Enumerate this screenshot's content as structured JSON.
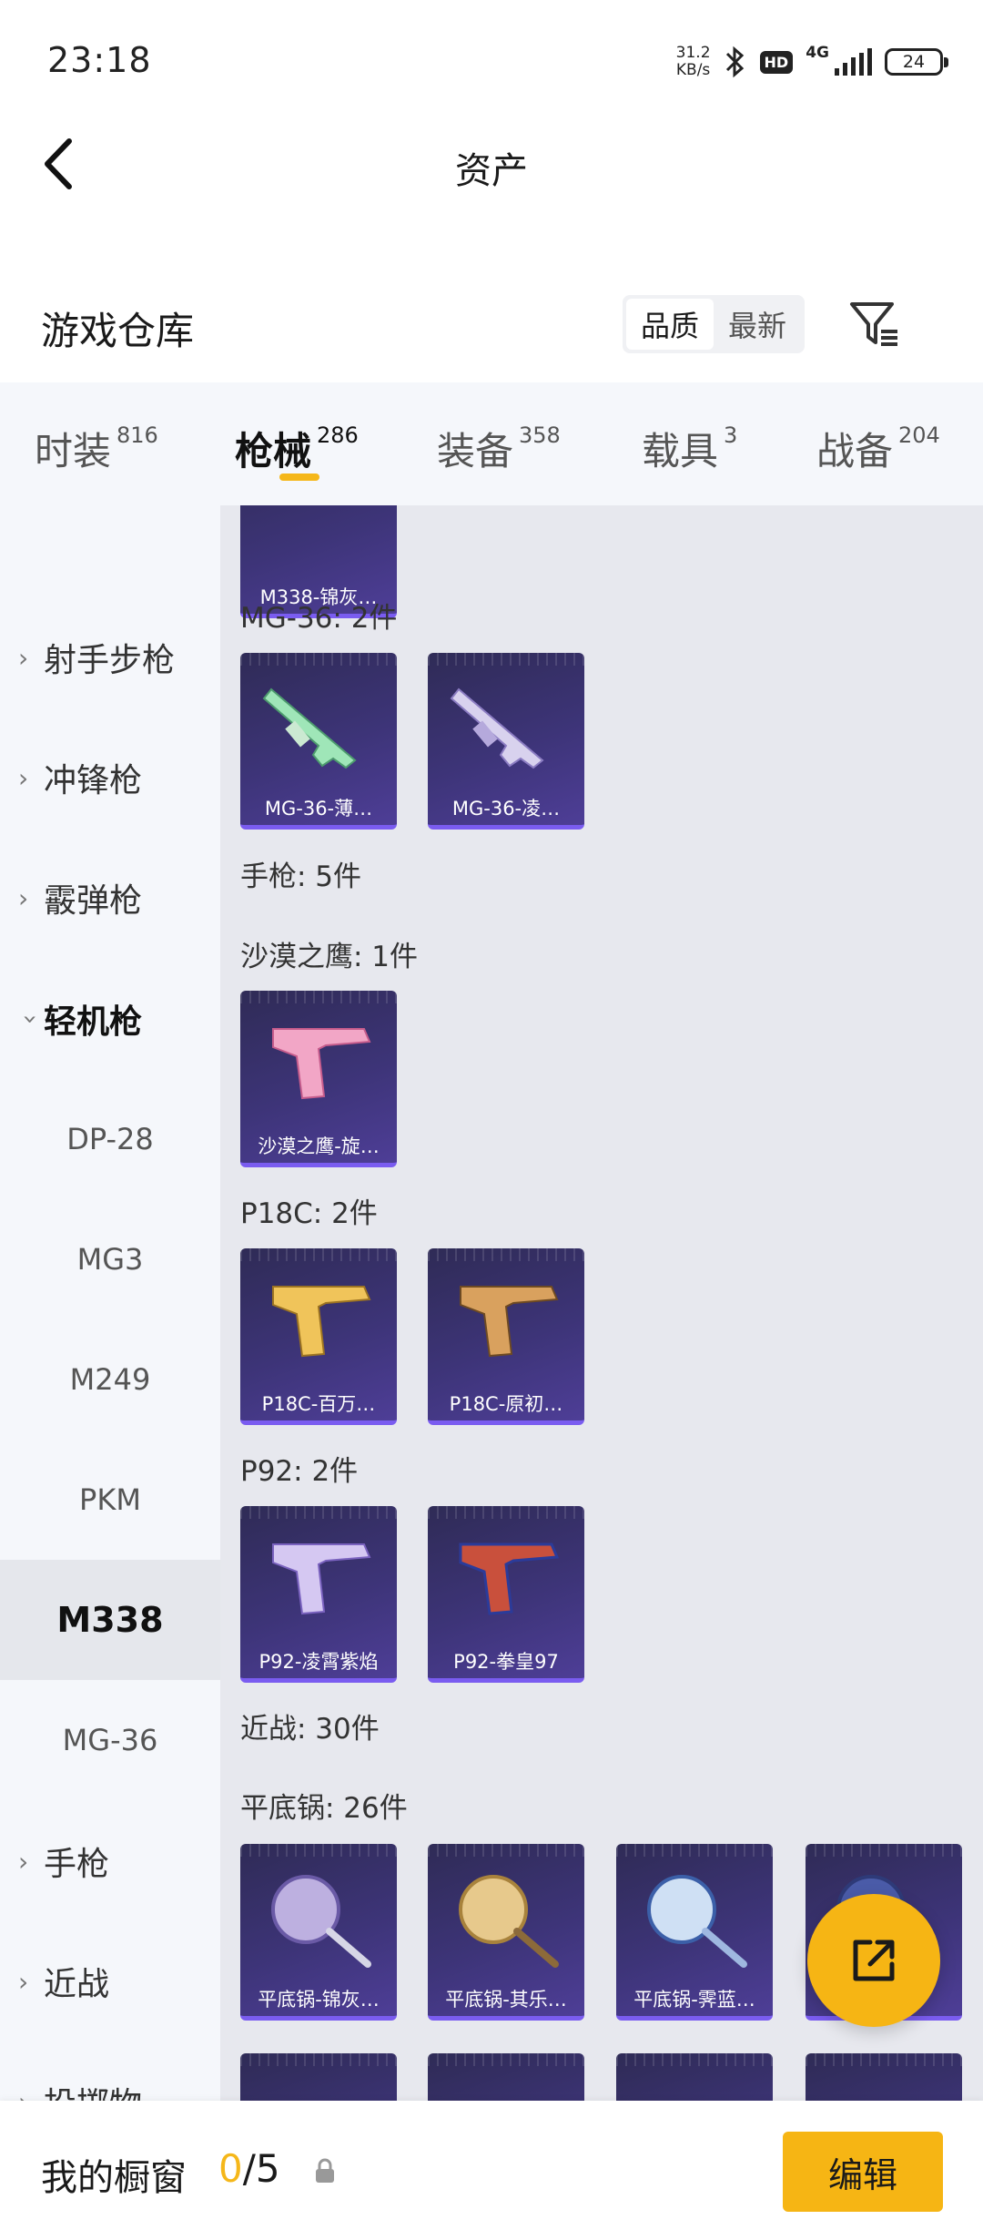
{
  "status_bar": {
    "time": "23:18",
    "net_speed_value": "31.2",
    "net_speed_unit": "KB/s",
    "hd_label": "HD",
    "network": "4G",
    "battery": "24"
  },
  "nav": {
    "title": "资产",
    "back_icon": "chevron-left-icon"
  },
  "warehouse": {
    "title": "游戏仓库",
    "sort_options": [
      "品质",
      "最新"
    ],
    "sort_selected": "品质",
    "filter_icon": "filter-icon"
  },
  "category_tabs": [
    {
      "label": "时装",
      "count": "816"
    },
    {
      "label": "枪械",
      "count": "286",
      "active": true
    },
    {
      "label": "装备",
      "count": "358"
    },
    {
      "label": "载具",
      "count": "3"
    },
    {
      "label": "战备",
      "count": "204"
    }
  ],
  "sidebar": {
    "groups": [
      {
        "label": "射手步枪"
      },
      {
        "label": "冲锋枪"
      },
      {
        "label": "霰弹枪"
      },
      {
        "label": "轻机枪",
        "open": true
      }
    ],
    "sub_items": [
      "DP-28",
      "MG3",
      "M249",
      "PKM",
      "M338",
      "MG-36"
    ],
    "selected_sub": "M338",
    "groups_after": [
      {
        "label": "手枪"
      },
      {
        "label": "近战"
      },
      {
        "label": "投掷物"
      }
    ]
  },
  "content": {
    "sections": [
      {
        "title": "MG-36: 2件"
      },
      {
        "title": "手枪: 5件"
      },
      {
        "title": "沙漠之鹰: 1件"
      },
      {
        "title": "P18C: 2件"
      },
      {
        "title": "P92: 2件"
      },
      {
        "title": "近战: 30件"
      },
      {
        "title": "平底锅: 26件"
      }
    ],
    "cards": {
      "m338": "M338-锦灰…",
      "mg36_1": "MG-36-薄…",
      "mg36_2": "MG-36-凌…",
      "deagle_1": "沙漠之鹰-旋…",
      "p18c_1": "P18C-百万…",
      "p18c_2": "P18C-原初…",
      "p92_1": "P92-凌霄紫焰",
      "p92_2": "P92-拳皇97",
      "pan_1": "平底锅-锦灰…",
      "pan_2": "平底锅-其乐…",
      "pan_3": "平底锅-霁蓝…",
      "pan_4": "…"
    }
  },
  "share_icon": "share-icon",
  "bottom_bar": {
    "label": "我的橱窗",
    "current": "0",
    "separator": "/",
    "max": "5",
    "lock_icon": "lock-icon",
    "edit_label": "编辑"
  },
  "colors": {
    "accent": "#f6b514",
    "card_bg": "#3d3478",
    "card_edge": "#7a5cf0"
  }
}
